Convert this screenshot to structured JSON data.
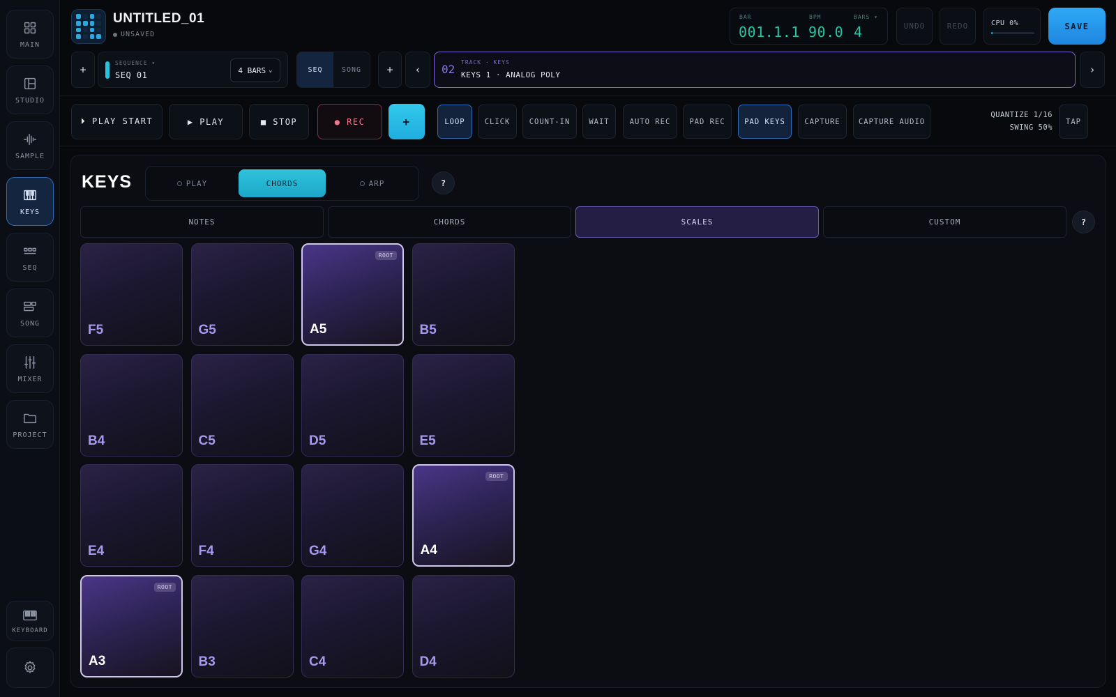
{
  "sidebar": {
    "items": [
      {
        "label": "MAIN",
        "icon": "grid-icon",
        "active": false
      },
      {
        "label": "STUDIO",
        "icon": "layout-icon",
        "active": false
      },
      {
        "label": "SAMPLE",
        "icon": "waveform-icon",
        "active": false
      },
      {
        "label": "KEYS",
        "icon": "piano-icon",
        "active": true
      },
      {
        "label": "SEQ",
        "icon": "sequencer-icon",
        "active": false
      },
      {
        "label": "SONG",
        "icon": "song-icon",
        "active": false
      },
      {
        "label": "MIXER",
        "icon": "sliders-icon",
        "active": false
      },
      {
        "label": "PROJECT",
        "icon": "folder-icon",
        "active": false
      }
    ],
    "keyboard_label": "KEYBOARD",
    "settings_icon": "gear-icon"
  },
  "header": {
    "title": "UNTITLED_01",
    "status": "UNSAVED",
    "bar_label": "BAR",
    "bar_value": "001.1.1",
    "bpm_label": "BPM",
    "bpm_value": "90.0",
    "bars_label": "BARS ▾",
    "bars_value": "4",
    "undo_label": "UNDO",
    "redo_label": "REDO",
    "cpu_label": "CPU 0%",
    "cpu_level": 0.04,
    "save_label": "SAVE"
  },
  "sequence_bar": {
    "add_label": "+",
    "sequence_caption": "SEQUENCE ▾",
    "sequence_name": "SEQ 01",
    "bars_select": "4 BARS",
    "mode_seq": "SEQ",
    "mode_song": "SONG",
    "add_track_label": "+",
    "prev_label": "‹",
    "next_label": "›",
    "track_number": "02",
    "track_caption": "TRACK · KEYS",
    "track_name": "KEYS 1 · ANALOG POLY"
  },
  "transport": {
    "play_start": "⏵ PLAY START",
    "play": "▶ PLAY",
    "stop": "■ STOP",
    "rec": "● REC",
    "add": "+",
    "options": [
      {
        "label": "LOOP",
        "on": true
      },
      {
        "label": "CLICK",
        "on": false
      },
      {
        "label": "COUNT-IN",
        "on": false
      },
      {
        "label": "WAIT",
        "on": false
      },
      {
        "label": "AUTO REC",
        "on": false
      },
      {
        "label": "PAD REC",
        "on": false
      },
      {
        "label": "PAD KEYS",
        "on": true
      },
      {
        "label": "CAPTURE",
        "on": false
      },
      {
        "label": "CAPTURE AUDIO",
        "on": false
      }
    ],
    "quantize": "QUANTIZE 1/16",
    "swing": "SWING 50%",
    "tap": "TAP"
  },
  "keys": {
    "title": "KEYS",
    "modes": [
      {
        "label": "PLAY",
        "active": false
      },
      {
        "label": "CHORDS",
        "active": true
      },
      {
        "label": "ARP",
        "active": false
      }
    ],
    "help": "?",
    "tabs": [
      {
        "label": "NOTES",
        "active": false
      },
      {
        "label": "CHORDS",
        "active": false
      },
      {
        "label": "SCALES",
        "active": true
      },
      {
        "label": "CUSTOM",
        "active": false
      }
    ],
    "root_badge": "ROOT",
    "pads": [
      {
        "note": "F5",
        "root": false
      },
      {
        "note": "G5",
        "root": false
      },
      {
        "note": "A5",
        "root": true
      },
      {
        "note": "B5",
        "root": false
      },
      {
        "note": "B4",
        "root": false
      },
      {
        "note": "C5",
        "root": false
      },
      {
        "note": "D5",
        "root": false
      },
      {
        "note": "E5",
        "root": false
      },
      {
        "note": "E4",
        "root": false
      },
      {
        "note": "F4",
        "root": false
      },
      {
        "note": "G4",
        "root": false
      },
      {
        "note": "A4",
        "root": true
      },
      {
        "note": "A3",
        "root": true
      },
      {
        "note": "B3",
        "root": false
      },
      {
        "note": "C4",
        "root": false
      },
      {
        "note": "D4",
        "root": false
      }
    ]
  }
}
